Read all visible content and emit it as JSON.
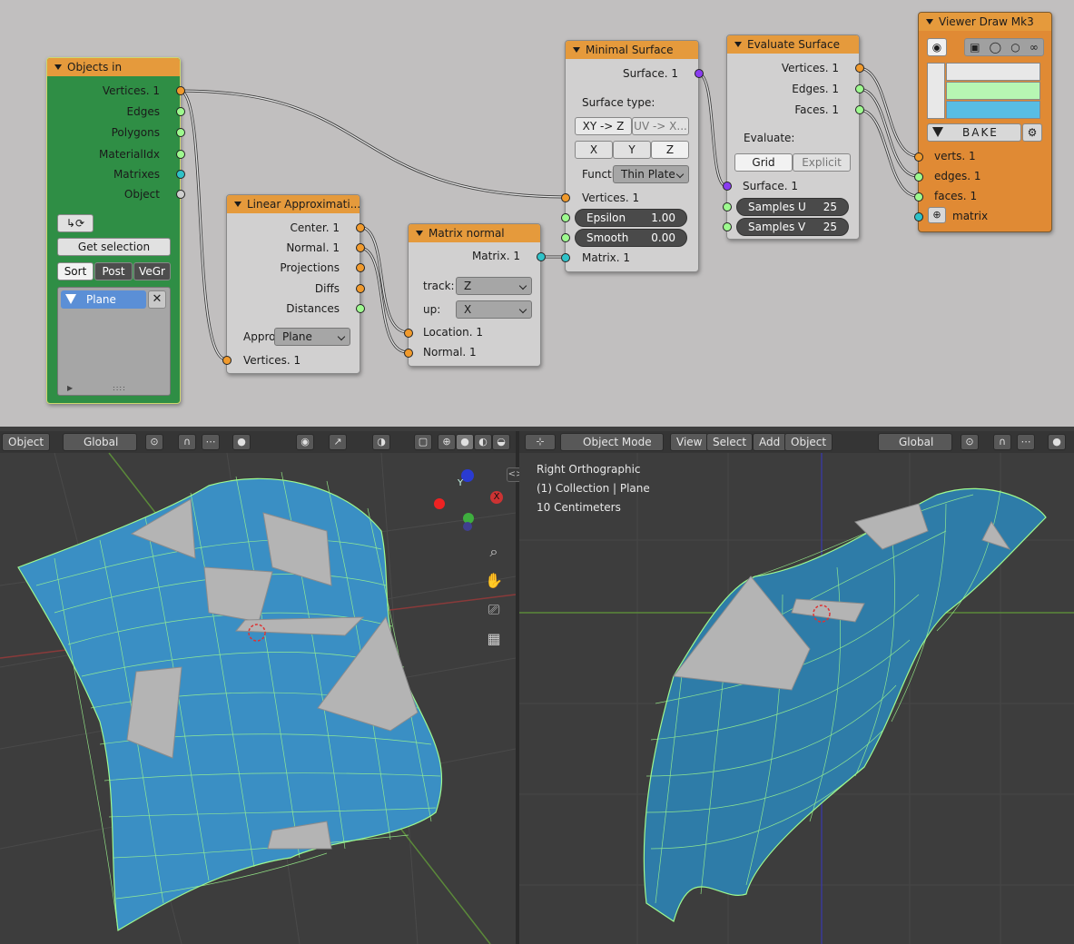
{
  "colors": {
    "vertex_socket": "#f09a2d",
    "string_socket": "#9ef98f",
    "matrix_socket": "#2fc2c8",
    "surface_socket": "#8a3df0",
    "node_header": "#e59a3c",
    "objects_node_body": "#2f8e45",
    "mesh_blue": "#3a8fc4",
    "mesh_grey": "#b4b4b4",
    "wire_edge": "#9ef98f"
  },
  "nodes": {
    "objects_in": {
      "title": "Objects in",
      "outputs": [
        "Vertices. 1",
        "Edges",
        "Polygons",
        "MaterialIdx",
        "Matrixes",
        "Object"
      ],
      "get_selection": "Get selection",
      "sort_tabs": [
        "Sort",
        "Post",
        "VeGr"
      ],
      "object_item": "Plane"
    },
    "linear_approx": {
      "title": "Linear Approximati...",
      "outputs": [
        "Center. 1",
        "Normal. 1",
        "Projections",
        "Diffs",
        "Distances"
      ],
      "approx_label": "Appro",
      "approx_value": "Plane",
      "input": "Vertices. 1"
    },
    "matrix_normal": {
      "title": "Matrix normal",
      "output": "Matrix. 1",
      "track_label": "track:",
      "track_value": "Z",
      "up_label": "up:",
      "up_value": "X",
      "inputs": [
        "Location. 1",
        "Normal. 1"
      ]
    },
    "minimal_surface": {
      "title": "Minimal Surface",
      "output": "Surface. 1",
      "type_label": "Surface type:",
      "type_options": [
        "XY -> Z",
        "UV -> X..."
      ],
      "axis_options": [
        "X",
        "Y",
        "Z"
      ],
      "func_label": "Functi",
      "func_value": "Thin Plate",
      "input_vertices": "Vertices. 1",
      "epsilon_label": "Epsilon",
      "epsilon_value": "1.00",
      "smooth_label": "Smooth",
      "smooth_value": "0.00",
      "input_matrix": "Matrix. 1"
    },
    "evaluate_surface": {
      "title": "Evaluate Surface",
      "outputs": [
        "Vertices. 1",
        "Edges. 1",
        "Faces. 1"
      ],
      "evaluate_label": "Evaluate:",
      "evaluate_options": [
        "Grid",
        "Explicit"
      ],
      "input_surface": "Surface. 1",
      "samples_u_label": "Samples U",
      "samples_u_value": "25",
      "samples_v_label": "Samples V",
      "samples_v_value": "25"
    },
    "viewer_draw": {
      "title": "Viewer Draw Mk3",
      "bake": "BAKE",
      "inputs": [
        "verts. 1",
        "edges. 1",
        "faces. 1",
        "matrix"
      ],
      "swatch_colors": [
        "#e8e8e8",
        "#b7f6b3",
        "#58bde4"
      ]
    }
  },
  "viewport_left": {
    "mode": "Object",
    "orientation": "Global"
  },
  "viewport_right": {
    "mode": "Object Mode",
    "menus": [
      "View",
      "Select",
      "Add",
      "Object"
    ],
    "orientation": "Global",
    "info_lines": [
      "Right Orthographic",
      "(1) Collection | Plane",
      "10 Centimeters"
    ]
  },
  "gizmo": {
    "y": "Y",
    "x": "X"
  }
}
